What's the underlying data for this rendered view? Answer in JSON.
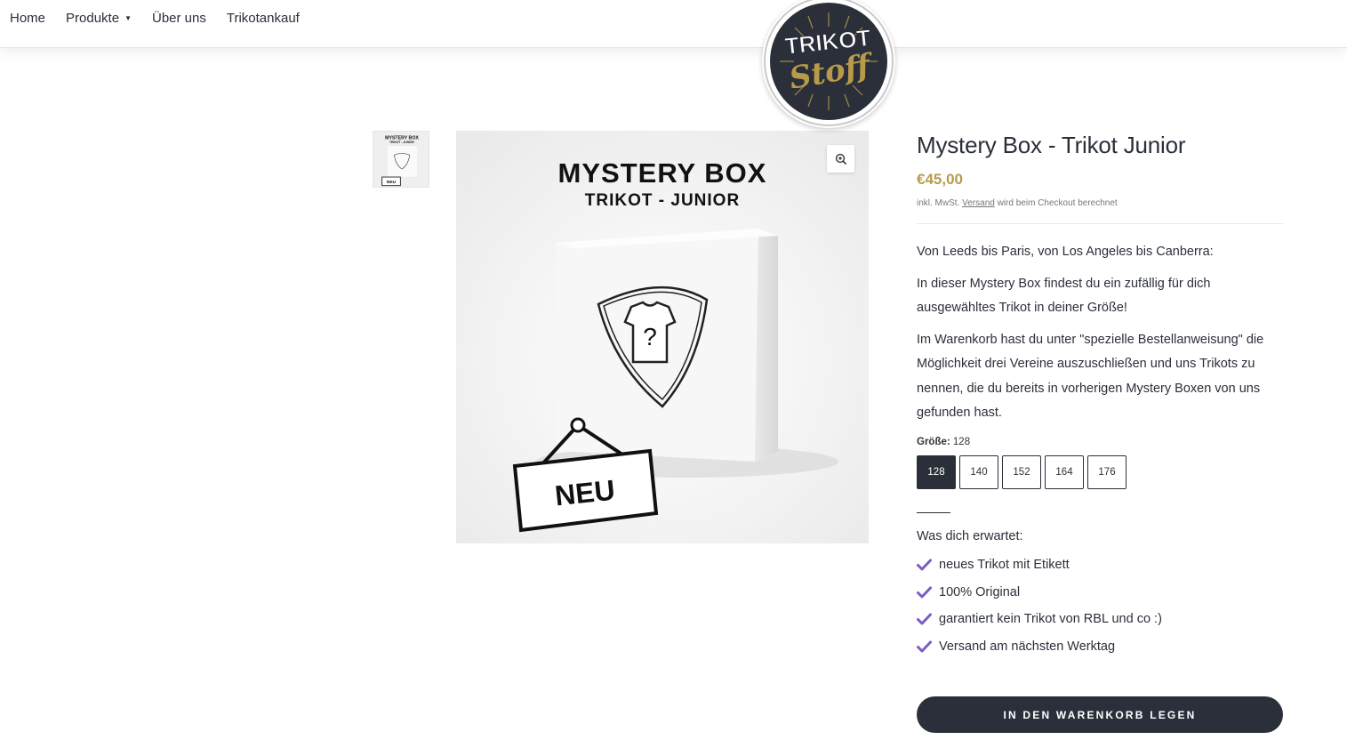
{
  "nav": {
    "items": [
      {
        "label": "Home"
      },
      {
        "label": "Produkte",
        "has_dropdown": true
      },
      {
        "label": "Über uns"
      },
      {
        "label": "Trikotankauf"
      }
    ],
    "dropdown_icon": "caret-down-icon"
  },
  "logo": {
    "line1": "TRIKOT",
    "line2": "Stoff"
  },
  "gallery": {
    "image_title": "MYSTERY BOX",
    "image_subtitle": "TRIKOT - JUNIOR",
    "image_tag": "NEU",
    "image_mark": "?",
    "zoom_icon": "zoom-in-icon"
  },
  "product": {
    "title": "Mystery Box - Trikot Junior",
    "price": "€45,00",
    "tax_prefix": "inkl. MwSt.",
    "tax_link": "Versand",
    "tax_suffix": "wird beim Checkout berechnet",
    "description": [
      "Von Leeds bis Paris, von Los Angeles bis Canberra:",
      "In dieser Mystery Box findest du ein zufällig für dich ausgewähltes Trikot in deiner Größe!",
      "Im Warenkorb hast du unter \"spezielle Bestellanweisung\" die Möglichkeit drei Vereine auszuschließen und uns Trikots zu nennen, die du bereits in vorherigen Mystery Boxen von uns gefunden hast."
    ],
    "size_label": "Größe:",
    "size_selected": "128",
    "sizes": [
      "128",
      "140",
      "152",
      "164",
      "176"
    ],
    "dash": "_____",
    "expect_heading": "Was dich erwartet:",
    "features": [
      "neues Trikot mit Etikett",
      "100% Original",
      "garantiert kein Trikot von RBL und co :)",
      "Versand am nächsten Werktag"
    ],
    "feature_icon": "check-icon",
    "check_color": "#7b5cc4",
    "add_to_cart": "IN DEN WARENKORB LEGEN"
  },
  "colors": {
    "accent_gold": "#b89a4a",
    "dark": "#2b2f3a"
  }
}
